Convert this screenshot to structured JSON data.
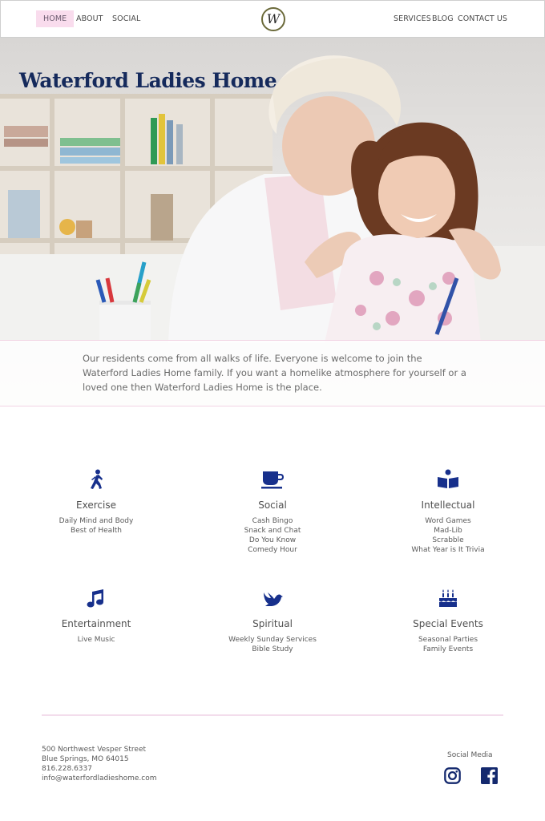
{
  "nav": {
    "left": [
      "HOME",
      "ABOUT",
      "SOCIAL"
    ],
    "right": [
      "SERVICES",
      "BLOG",
      "CONTACT US"
    ],
    "logo": "W"
  },
  "hero": {
    "title": "Waterford Ladies Home",
    "caption": "Our residents come from all walks of life. Everyone is welcome to join the Waterford Ladies Home family. If you want a homelike atmosphere for yourself or a loved one then Waterford Ladies Home is the place."
  },
  "features": [
    {
      "title": "Exercise",
      "icon": "walking-person-icon",
      "lines": [
        "Daily Mind and Body",
        "Best of Health"
      ]
    },
    {
      "title": "Social",
      "icon": "coffee-cup-icon",
      "lines": [
        "Cash Bingo",
        "Snack and Chat",
        "Do You Know",
        "Comedy Hour"
      ]
    },
    {
      "title": "Intellectual",
      "icon": "reading-person-icon",
      "lines": [
        "Word Games",
        "Mad-Lib",
        "Scrabble",
        "What Year is It Trivia"
      ]
    },
    {
      "title": "Entertainment",
      "icon": "music-note-icon",
      "lines": [
        "Live Music"
      ]
    },
    {
      "title": "Spiritual",
      "icon": "dove-icon",
      "lines": [
        "Weekly Sunday Services",
        "Bible Study"
      ]
    },
    {
      "title": "Special Events",
      "icon": "birthday-cake-icon",
      "lines": [
        "Seasonal Parties",
        "Family Events"
      ]
    }
  ],
  "footer": {
    "address": [
      "500 Northwest Vesper Street",
      "Blue Springs, MO 64015",
      "816.228.6337",
      "info@waterfordladieshome.com"
    ],
    "social_label": "Social Media"
  },
  "colors": {
    "accent_pink": "#f9dced",
    "icon_blue": "#17308c",
    "title_navy": "#152a5c"
  }
}
